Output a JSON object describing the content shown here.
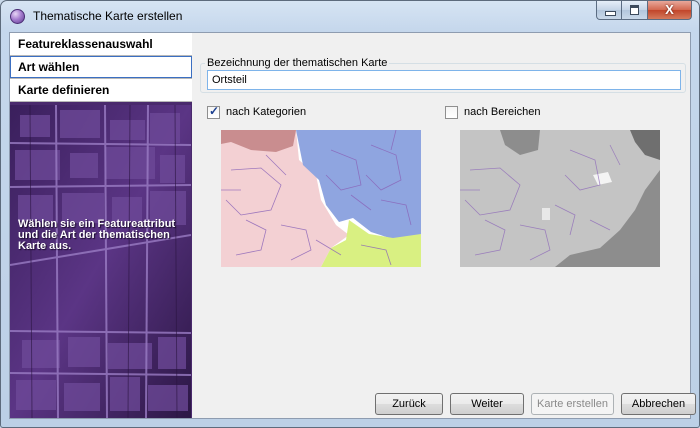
{
  "window": {
    "title": "Thematische Karte erstellen",
    "icon": "app-sphere-icon",
    "controls": [
      "minimize-icon",
      "maximize-icon",
      "close-icon"
    ],
    "close_glyph": "X"
  },
  "sidebar": {
    "items": [
      {
        "label": "Featureklassenauswahl",
        "active": false
      },
      {
        "label": "Art wählen",
        "active": true
      },
      {
        "label": "Karte definieren",
        "active": false
      }
    ],
    "description": "Wählen sie ein Featureattribut und die Art der thematischen Karte aus."
  },
  "main": {
    "name_group_label": "Bezeichnung der thematischen Karte",
    "name_value": "Ortsteil",
    "options": [
      {
        "label": "nach Kategorien",
        "checked": true
      },
      {
        "label": "nach Bereichen",
        "checked": false
      }
    ]
  },
  "buttons": {
    "back": "Zurück",
    "next": "Weiter",
    "create": "Karte erstellen",
    "cancel": "Abbrechen"
  },
  "colors": {
    "category_pink": "#f3d0d3",
    "category_blue": "#8fa5e0",
    "category_green": "#d9f082",
    "category_brown": "#c98d8f",
    "range_light": "#c4c4c4",
    "range_dark": "#8d8d8d",
    "boundary": "#8a63b8",
    "accent": "#3b6fc2"
  }
}
